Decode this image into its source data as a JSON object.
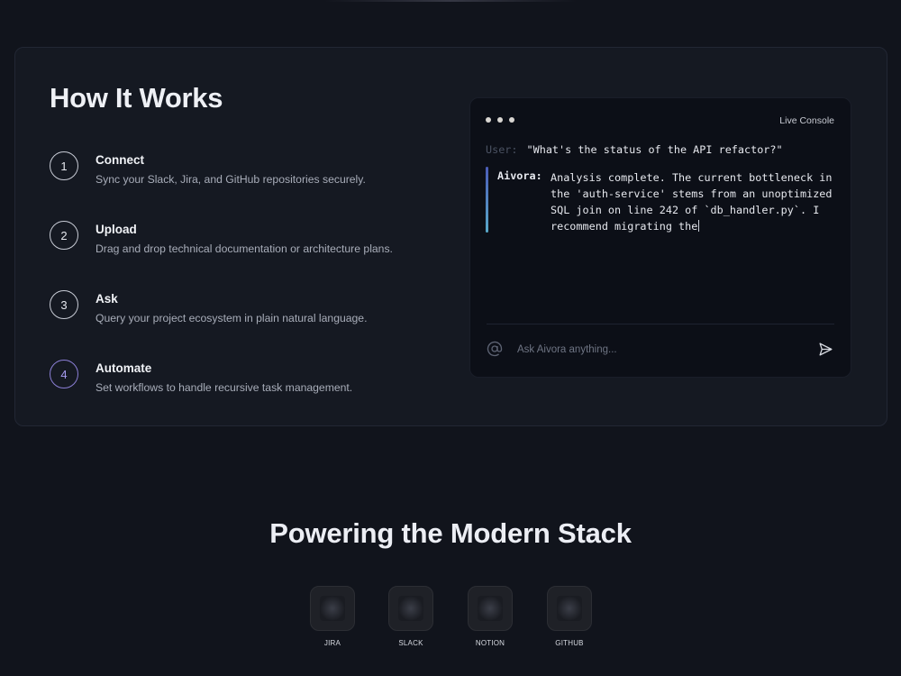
{
  "how_it_works": {
    "title": "How It Works",
    "steps": [
      {
        "number": "1",
        "title": "Connect",
        "description": "Sync your Slack, Jira, and GitHub repositories securely."
      },
      {
        "number": "2",
        "title": "Upload",
        "description": "Drag and drop technical documentation or architecture plans."
      },
      {
        "number": "3",
        "title": "Ask",
        "description": "Query your project ecosystem in plain natural language."
      },
      {
        "number": "4",
        "title": "Automate",
        "description": "Set workflows to handle recursive task management."
      }
    ]
  },
  "console": {
    "label": "Live Console",
    "user_label": "User:",
    "user_message": "\"What's the status of the API refactor?\"",
    "assistant_label": "Aivora:",
    "assistant_message": "Analysis complete. The current bottleneck in the 'auth-service' stems from an unoptimized SQL join on line 242 of `db_handler.py`. I recommend migrating the",
    "input_placeholder": "Ask Aivora anything...",
    "icons": {
      "input": "at-icon",
      "send": "send-icon"
    }
  },
  "stack": {
    "title": "Powering the Modern Stack",
    "integrations": [
      {
        "name": "JIRA"
      },
      {
        "name": "SLACK"
      },
      {
        "name": "NOTION"
      },
      {
        "name": "GITHUB"
      }
    ]
  },
  "colors": {
    "background": "#11141c",
    "card": "#151922",
    "console": "#0c0f17",
    "accent": "#8b7fd6"
  }
}
